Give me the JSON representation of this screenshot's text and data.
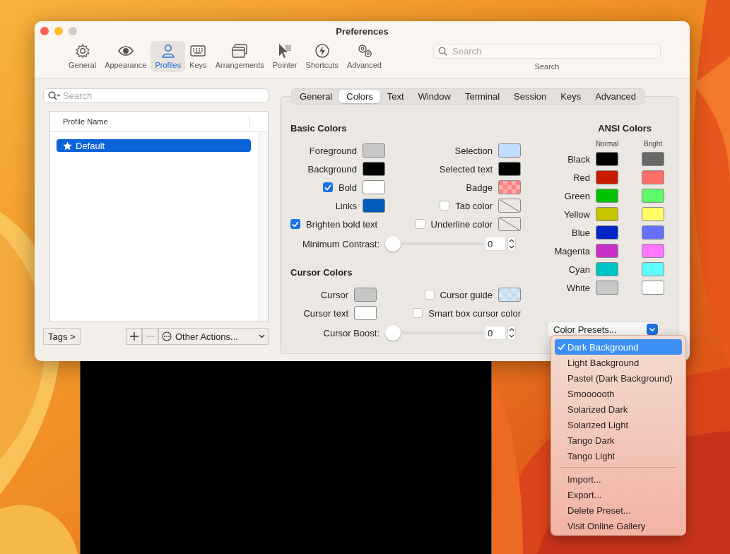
{
  "window": {
    "title": "Preferences"
  },
  "toolbar": {
    "items": [
      {
        "label": "General",
        "selected": false
      },
      {
        "label": "Appearance",
        "selected": false
      },
      {
        "label": "Profiles",
        "selected": true
      },
      {
        "label": "Keys",
        "selected": false
      },
      {
        "label": "Arrangements",
        "selected": false
      },
      {
        "label": "Pointer",
        "selected": false
      },
      {
        "label": "Shortcuts",
        "selected": false
      },
      {
        "label": "Advanced",
        "selected": false
      }
    ],
    "search": {
      "placeholder": "Search",
      "label": "Search"
    }
  },
  "profiles": {
    "search_placeholder": "Search",
    "column": "Profile Name",
    "rows": [
      {
        "name": "Default",
        "selected": true
      }
    ],
    "tags_button": "Tags >",
    "remove_disabled": true,
    "other_actions": "Other Actions..."
  },
  "tabs": [
    {
      "label": "General",
      "selected": false
    },
    {
      "label": "Colors",
      "selected": true
    },
    {
      "label": "Text",
      "selected": false
    },
    {
      "label": "Window",
      "selected": false
    },
    {
      "label": "Terminal",
      "selected": false
    },
    {
      "label": "Session",
      "selected": false
    },
    {
      "label": "Keys",
      "selected": false
    },
    {
      "label": "Advanced",
      "selected": false
    }
  ],
  "basic_colors": {
    "title": "Basic Colors",
    "rows": [
      {
        "left": {
          "kind": "swatch",
          "label": "Foreground",
          "swatch": {
            "kind": "solid",
            "color": "#c7c7c7"
          }
        },
        "right": {
          "kind": "swatch",
          "label": "Selection",
          "swatch": {
            "kind": "solid",
            "color": "#c1ddff"
          }
        }
      },
      {
        "left": {
          "kind": "swatch",
          "label": "Background",
          "swatch": {
            "kind": "solid",
            "color": "#000000"
          }
        },
        "right": {
          "kind": "swatch",
          "label": "Selected text",
          "swatch": {
            "kind": "solid",
            "color": "#000000"
          }
        }
      },
      {
        "left": {
          "kind": "check_swatch",
          "label": "Bold",
          "checked": true,
          "swatch": {
            "kind": "solid",
            "color": "#ffffff"
          }
        },
        "right": {
          "kind": "swatch",
          "label": "Badge",
          "swatch": {
            "kind": "checker",
            "color": "#ff8080"
          }
        }
      },
      {
        "left": {
          "kind": "swatch",
          "label": "Links",
          "swatch": {
            "kind": "solid",
            "color": "#005bbb"
          }
        },
        "right": {
          "kind": "check_swatch",
          "label": "Tab color",
          "checked": false,
          "swatch": {
            "kind": "none"
          }
        }
      },
      {
        "left": {
          "kind": "check",
          "label": "Brighten bold text",
          "checked": true
        },
        "right": {
          "kind": "check_swatch",
          "label": "Underline color",
          "checked": false,
          "swatch": {
            "kind": "none"
          }
        }
      }
    ],
    "slider": {
      "label": "Minimum Contrast:",
      "level": 0,
      "value": "0"
    }
  },
  "cursor_colors": {
    "title": "Cursor Colors",
    "rows": [
      {
        "left": {
          "kind": "swatch",
          "label": "Cursor",
          "swatch": {
            "kind": "solid",
            "color": "#c7c7c7"
          }
        },
        "right": {
          "kind": "check_swatch",
          "label": "Cursor guide",
          "checked": false,
          "swatch": {
            "kind": "checker",
            "color": "#c5dcef"
          }
        }
      },
      {
        "left": {
          "kind": "swatch",
          "label": "Cursor text",
          "swatch": {
            "kind": "solid",
            "color": "#ffffff"
          }
        },
        "right": {
          "kind": "check",
          "label": "Smart box cursor color",
          "checked": false
        }
      }
    ],
    "slider": {
      "label": "Cursor Boost:",
      "level": 0,
      "value": "0"
    }
  },
  "ansi_colors": {
    "title": "ANSI Colors",
    "normal_header": "Normal",
    "bright_header": "Bright",
    "rows": [
      {
        "name": "Black",
        "normal": {
          "color": "#000000"
        },
        "bright": {
          "color": "#686868"
        }
      },
      {
        "name": "Red",
        "normal": {
          "color": "#c91b00"
        },
        "bright": {
          "color": "#ff6e67"
        }
      },
      {
        "name": "Green",
        "normal": {
          "color": "#00c200"
        },
        "bright": {
          "color": "#5ffa68"
        }
      },
      {
        "name": "Yellow",
        "normal": {
          "color": "#c7c400"
        },
        "bright": {
          "color": "#fffc67"
        }
      },
      {
        "name": "Blue",
        "normal": {
          "color": "#0225c7"
        },
        "bright": {
          "color": "#6871ff"
        }
      },
      {
        "name": "Magenta",
        "normal": {
          "color": "#c930c7"
        },
        "bright": {
          "color": "#ff77ff"
        }
      },
      {
        "name": "Cyan",
        "normal": {
          "color": "#00c5c7"
        },
        "bright": {
          "color": "#60fdff"
        }
      },
      {
        "name": "White",
        "normal": {
          "color": "#c7c7c7"
        },
        "bright": {
          "color": "#ffffff"
        }
      }
    ]
  },
  "color_presets": {
    "button": "Color Presets...",
    "menu": {
      "presets": [
        {
          "label": "Dark Background",
          "selected": true
        },
        {
          "label": "Light Background",
          "selected": false
        },
        {
          "label": "Pastel (Dark Background)",
          "selected": false
        },
        {
          "label": "Smoooooth",
          "selected": false
        },
        {
          "label": "Solarized Dark",
          "selected": false
        },
        {
          "label": "Solarized Light",
          "selected": false
        },
        {
          "label": "Tango Dark",
          "selected": false
        },
        {
          "label": "Tango Light",
          "selected": false
        }
      ],
      "actions": [
        "Import...",
        "Export...",
        "Delete Preset...",
        "Visit Online Gallery"
      ]
    }
  }
}
